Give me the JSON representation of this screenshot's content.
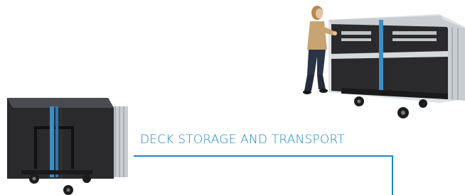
{
  "caption": {
    "text": "DECK STORAGE AND TRANSPORT"
  },
  "colors": {
    "accent": "#1f87c4",
    "strap": "#3a8fc8",
    "deck_panel": "#2a2a2c",
    "frame_aluminum": "#c9cdd1",
    "caster": "#1c1c1c"
  },
  "icons": {
    "small_cart": "deck-cart-small-icon",
    "large_cart": "deck-cart-large-icon",
    "person": "person-pushing-cart-icon"
  }
}
